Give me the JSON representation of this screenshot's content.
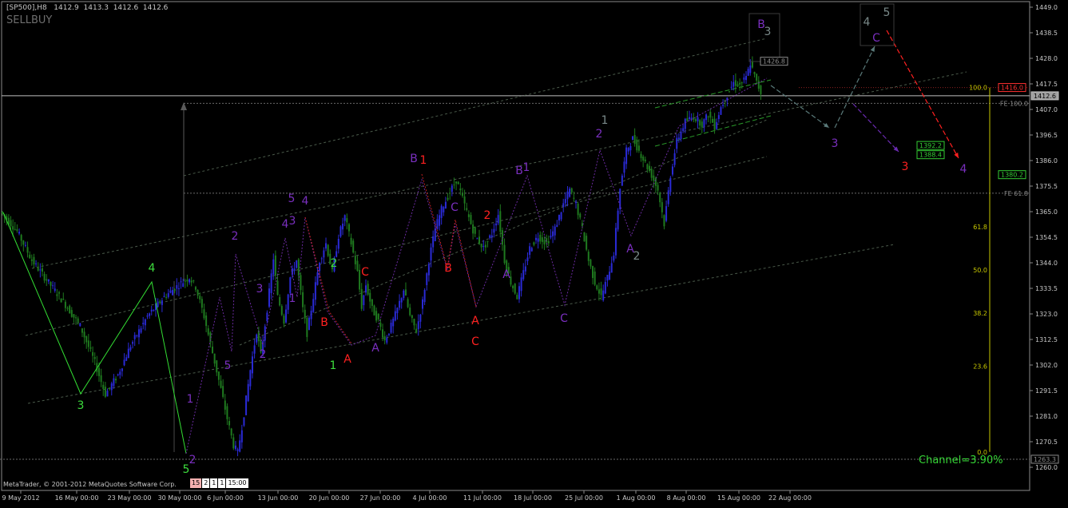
{
  "header": {
    "symbol_line": "[SP500],H8   1412.9  1413.3  1412.6  1412.6",
    "indicator": "SELLBUY"
  },
  "footer": {
    "copyright": "MetaTrader, © 2001-2012 MetaQuotes Software Corp.",
    "timeframes": [
      "15",
      "2",
      "1",
      "1",
      "15:00"
    ],
    "channel_label": "Channel=3.90%"
  },
  "colors": {
    "background": "#000000",
    "bull_candle": "#2a2ad6",
    "bear_candle": "#1f7a1f",
    "green_label": "#3ddc3d",
    "purple_label": "#7a2fbf",
    "red_label": "#ff2020",
    "gray_label": "#7a8a8a",
    "fib_line": "#c8c800",
    "bid_line": "#bfbfbf"
  },
  "chart_data": {
    "type": "candlestick",
    "title": "",
    "y_axis": {
      "min": 1258,
      "max": 1450,
      "ticks": [
        1449.0,
        1438.5,
        1428.0,
        1417.5,
        1407.0,
        1396.5,
        1386.0,
        1375.5,
        1365.0,
        1354.5,
        1344.0,
        1333.5,
        1323.0,
        1312.5,
        1302.0,
        1291.5,
        1281.0,
        1270.5,
        1260.0
      ]
    },
    "x_axis": {
      "ticks": [
        "9 May 2012",
        "16 May 00:00",
        "23 May 00:00",
        "30 May 00:00",
        "6 Jun 00:00",
        "13 Jun 00:00",
        "20 Jun 00:00",
        "27 Jun 00:00",
        "4 Jul 00:00",
        "11 Jul 00:00",
        "18 Jul 00:00",
        "25 Jul 00:00",
        "1 Aug 00:00",
        "8 Aug 00:00",
        "15 Aug 00:00",
        "22 Aug 00:00"
      ]
    },
    "price_path": [
      [
        0,
        1365
      ],
      [
        8,
        1357
      ],
      [
        15,
        1345
      ],
      [
        22,
        1337
      ],
      [
        30,
        1328
      ],
      [
        38,
        1318
      ],
      [
        45,
        1303
      ],
      [
        50,
        1290
      ],
      [
        56,
        1298
      ],
      [
        62,
        1310
      ],
      [
        70,
        1322
      ],
      [
        78,
        1330
      ],
      [
        85,
        1335
      ],
      [
        90,
        1338
      ],
      [
        93,
        1334
      ],
      [
        97,
        1322
      ],
      [
        101,
        1307
      ],
      [
        105,
        1292
      ],
      [
        108,
        1280
      ],
      [
        111,
        1269
      ],
      [
        113,
        1266
      ],
      [
        116,
        1282
      ],
      [
        119,
        1300
      ],
      [
        122,
        1316
      ],
      [
        124,
        1306
      ],
      [
        127,
        1325
      ],
      [
        130,
        1346
      ],
      [
        132,
        1330
      ],
      [
        135,
        1320
      ],
      [
        138,
        1338
      ],
      [
        141,
        1345
      ],
      [
        144,
        1325
      ],
      [
        146,
        1315
      ],
      [
        149,
        1330
      ],
      [
        152,
        1345
      ],
      [
        155,
        1352
      ],
      [
        158,
        1340
      ],
      [
        161,
        1355
      ],
      [
        164,
        1363
      ],
      [
        167,
        1352
      ],
      [
        170,
        1340
      ],
      [
        172,
        1326
      ],
      [
        174,
        1335
      ],
      [
        177,
        1325
      ],
      [
        180,
        1320
      ],
      [
        183,
        1312
      ],
      [
        186,
        1318
      ],
      [
        189,
        1325
      ],
      [
        192,
        1333
      ],
      [
        195,
        1322
      ],
      [
        198,
        1316
      ],
      [
        201,
        1328
      ],
      [
        204,
        1345
      ],
      [
        207,
        1358
      ],
      [
        210,
        1366
      ],
      [
        214,
        1373
      ],
      [
        217,
        1378
      ],
      [
        219,
        1373
      ],
      [
        222,
        1365
      ],
      [
        226,
        1355
      ],
      [
        230,
        1350
      ],
      [
        234,
        1356
      ],
      [
        237,
        1364
      ],
      [
        240,
        1345
      ],
      [
        243,
        1336
      ],
      [
        246,
        1330
      ],
      [
        249,
        1340
      ],
      [
        252,
        1350
      ],
      [
        256,
        1355
      ],
      [
        260,
        1352
      ],
      [
        264,
        1358
      ],
      [
        268,
        1368
      ],
      [
        271,
        1374
      ],
      [
        274,
        1368
      ],
      [
        277,
        1358
      ],
      [
        280,
        1345
      ],
      [
        283,
        1336
      ],
      [
        286,
        1330
      ],
      [
        289,
        1338
      ],
      [
        292,
        1348
      ],
      [
        295,
        1375
      ],
      [
        298,
        1390
      ],
      [
        301,
        1395
      ],
      [
        304,
        1390
      ],
      [
        307,
        1385
      ],
      [
        310,
        1380
      ],
      [
        313,
        1374
      ],
      [
        316,
        1360
      ],
      [
        319,
        1380
      ],
      [
        322,
        1394
      ],
      [
        326,
        1402
      ],
      [
        330,
        1404
      ],
      [
        334,
        1401
      ],
      [
        337,
        1405
      ],
      [
        340,
        1400
      ],
      [
        343,
        1408
      ],
      [
        346,
        1413
      ],
      [
        349,
        1418
      ],
      [
        352,
        1417
      ],
      [
        355,
        1420
      ],
      [
        357,
        1426
      ],
      [
        360,
        1418
      ],
      [
        362,
        1414
      ]
    ],
    "price_path_x_units": "8-hour bars since 9 May 2012",
    "wave_labels": [
      {
        "text": "3",
        "price": 1288,
        "color": "green"
      },
      {
        "text": "4",
        "price": 1344,
        "color": "green"
      },
      {
        "text": "5",
        "price": 1262,
        "color": "green"
      },
      {
        "text": "2",
        "price": 1265,
        "color": "purple"
      },
      {
        "text": "1",
        "price": 1285,
        "color": "purple"
      },
      {
        "text": "2",
        "price": 1311,
        "color": "purple"
      },
      {
        "text": "3",
        "price": 1334,
        "color": "purple"
      },
      {
        "text": "4",
        "price": 1304,
        "color": "purple"
      },
      {
        "text": "5",
        "price": 1353,
        "color": "purple"
      },
      {
        "text": "1",
        "price": 1334,
        "color": "purple"
      },
      {
        "text": "2",
        "price": 1311,
        "color": "purple"
      },
      {
        "text": "3",
        "price": 1361,
        "color": "purple"
      },
      {
        "text": "4",
        "price": 1328,
        "color": "purple"
      },
      {
        "text": "5",
        "price": 1366,
        "color": "purple"
      },
      {
        "text": "1",
        "price": 1368,
        "color": "green"
      },
      {
        "text": "2",
        "price": 1302,
        "color": "green"
      },
      {
        "text": "B",
        "price": 1342,
        "color": "red"
      },
      {
        "text": "A",
        "price": 1318,
        "color": "red"
      },
      {
        "text": "C",
        "price": 1305,
        "color": "red"
      },
      {
        "text": "A",
        "price": 1337,
        "color": "purple"
      },
      {
        "text": "B",
        "price": 1308,
        "color": "purple"
      },
      {
        "text": "1",
        "price": 1390,
        "color": "red"
      },
      {
        "text": "C",
        "price": 1389,
        "color": "purple"
      },
      {
        "text": "B",
        "price": 1365,
        "color": "red"
      },
      {
        "text": "A",
        "price": 1343,
        "color": "red"
      },
      {
        "text": "C",
        "price": 1320,
        "color": "red"
      },
      {
        "text": "2",
        "price": 1310,
        "color": "red"
      },
      {
        "text": "A",
        "price": 1363,
        "color": "purple"
      },
      {
        "text": "B",
        "price": 1336,
        "color": "purple"
      },
      {
        "text": "1",
        "price": 1387,
        "color": "purple"
      },
      {
        "text": "C",
        "price": 1387,
        "color": "purple"
      },
      {
        "text": "2",
        "price": 1322,
        "color": "purple"
      },
      {
        "text": "1",
        "price": 1399,
        "color": "gray"
      },
      {
        "text": "A",
        "price": 1403,
        "color": "purple"
      },
      {
        "text": "2",
        "price": 1349,
        "color": "gray"
      },
      {
        "text": "B",
        "price": 1347,
        "color": "purple"
      },
      {
        "text": "3",
        "price": 1435,
        "color": "gray"
      },
      {
        "text": "3",
        "price": 1442,
        "color": "purple"
      },
      {
        "text": "4",
        "price": 1394,
        "color": "gray"
      },
      {
        "text": "C",
        "price": 1443,
        "color": "purple"
      },
      {
        "text": "5",
        "price": 1440,
        "color": "gray"
      },
      {
        "text": "3",
        "price": 1447,
        "color": "red"
      },
      {
        "text": "4",
        "price": 1387,
        "color": "purple"
      },
      {
        "text": "4",
        "price": 1386,
        "color": "red"
      }
    ],
    "fib_levels": [
      {
        "label": "100.0",
        "price": 1416.0
      },
      {
        "label": "61.8",
        "price": 1358.8
      },
      {
        "label": "50.0",
        "price": 1341.0
      },
      {
        "label": "38.2",
        "price": 1323.4
      },
      {
        "label": "23.6",
        "price": 1301.5
      },
      {
        "label": "0.0",
        "price": 1266.3
      }
    ],
    "fe_labels": [
      {
        "label": "FE 100.0",
        "price": 1409.5
      },
      {
        "label": "FE 61.8",
        "price": 1372.6
      }
    ],
    "price_boxes": [
      {
        "label": "1426.8",
        "price": 1426.8,
        "color": "gray"
      },
      {
        "label": "1416.0",
        "price": 1416.0,
        "color": "red"
      },
      {
        "label": "1412.6",
        "price": 1412.6,
        "color": "bid"
      },
      {
        "label": "1392.2",
        "price": 1392.2,
        "color": "green"
      },
      {
        "label": "1388.4",
        "price": 1388.4,
        "color": "green"
      },
      {
        "label": "1380.2",
        "price": 1380.2,
        "color": "green"
      },
      {
        "label": "1263.3",
        "price": 1263.3,
        "color": "gray"
      }
    ]
  }
}
